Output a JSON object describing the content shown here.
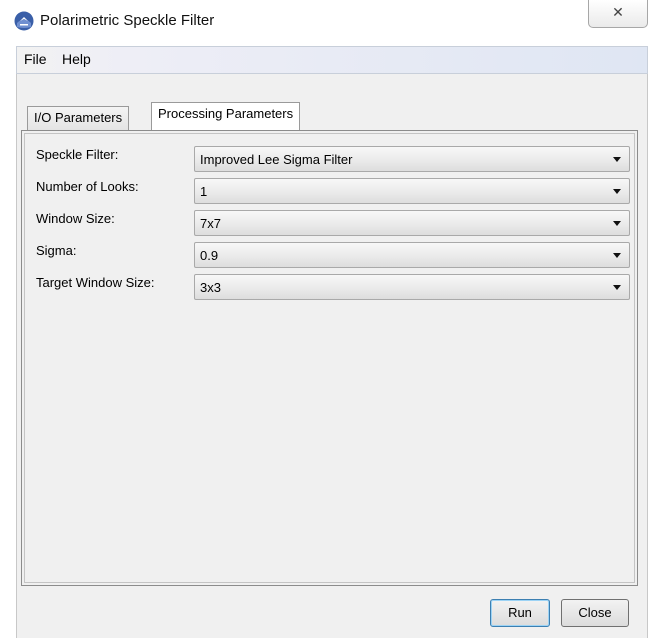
{
  "window": {
    "title": "Polarimetric Speckle Filter",
    "close_glyph": "✕",
    "icon": "satellite-globe-icon"
  },
  "menu": {
    "items": [
      {
        "label": "File"
      },
      {
        "label": "Help"
      }
    ]
  },
  "tabs": [
    {
      "label": "I/O Parameters",
      "active": false
    },
    {
      "label": "Processing Parameters",
      "active": true
    }
  ],
  "form": {
    "rows": [
      {
        "label": "Speckle Filter:",
        "value": "Improved Lee Sigma Filter"
      },
      {
        "label": "Number of Looks:",
        "value": "1"
      },
      {
        "label": "Window Size:",
        "value": "7x7"
      },
      {
        "label": "Sigma:",
        "value": "0.9"
      },
      {
        "label": "Target Window Size:",
        "value": "3x3"
      }
    ]
  },
  "buttons": {
    "run_label": "Run",
    "close_label": "Close"
  }
}
